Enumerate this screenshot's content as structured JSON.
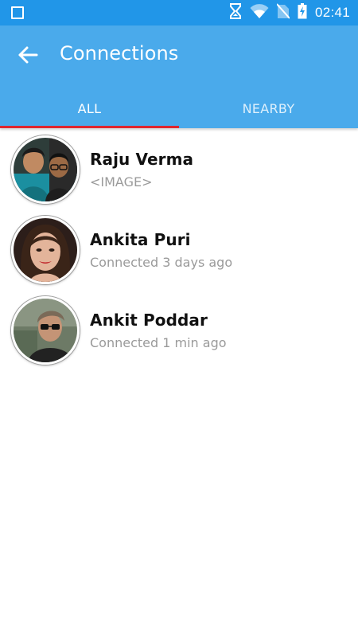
{
  "status_bar": {
    "time": "02:41",
    "icons": [
      "notification-square-icon",
      "sync-icon",
      "wifi-icon",
      "no-sim-icon",
      "battery-charging-icon"
    ]
  },
  "app_bar": {
    "back_icon": "arrow-left-icon",
    "title": "Connections",
    "color": "#4aaaeb"
  },
  "tabs": [
    {
      "label": "ALL",
      "selected": true
    },
    {
      "label": "NEARBY",
      "selected": false
    }
  ],
  "tab_indicator_color": "#e0262f",
  "connections": [
    {
      "name": "Raju Verma",
      "subtitle": "<IMAGE>"
    },
    {
      "name": "Ankita Puri",
      "subtitle": "Connected 3 days ago"
    },
    {
      "name": "Ankit Poddar",
      "subtitle": "Connected 1 min ago"
    }
  ]
}
